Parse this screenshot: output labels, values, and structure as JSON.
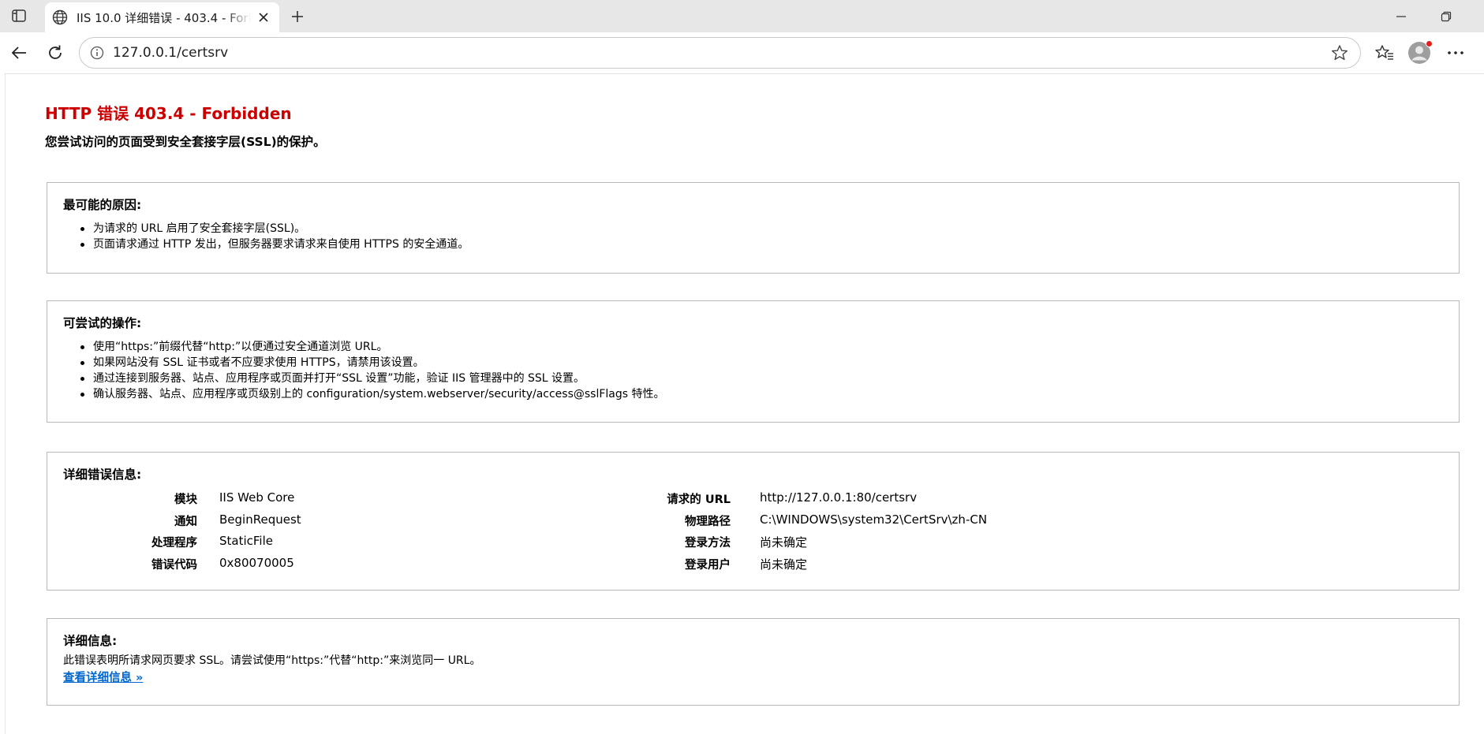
{
  "browser": {
    "tab": {
      "title": "IIS 10.0 详细错误 - 403.4 - Forbidden"
    },
    "address": {
      "url": "127.0.0.1/certsrv"
    },
    "icons": {
      "tab_actions": "tab-actions-icon",
      "favicon": "globe-icon",
      "close": "close-icon",
      "new_tab": "plus-icon",
      "back": "back-arrow-icon",
      "refresh": "refresh-icon",
      "site_info": "info-icon",
      "favorite": "star-icon",
      "favorites_bar": "favorites-icon",
      "profile": "profile-icon",
      "more": "more-icon",
      "minimize": "minimize-icon",
      "restore": "restore-icon"
    },
    "colors": {
      "tabbar_bg": "#e7e7e7",
      "profile_badge": "#e0201c"
    }
  },
  "page": {
    "title": "HTTP 错误 403.4 - Forbidden",
    "subtitle": "您尝试访问的页面受到安全套接字层(SSL)的保护。",
    "title_color": "#cc0000",
    "causes": {
      "heading": "最可能的原因:",
      "items": [
        "为请求的 URL 启用了安全套接字层(SSL)。",
        "页面请求通过 HTTP 发出，但服务器要求请求来自使用 HTTPS 的安全通道。"
      ]
    },
    "actions": {
      "heading": "可尝试的操作:",
      "items": [
        "使用“https:”前缀代替“http:”以便通过安全通道浏览 URL。",
        "如果网站没有 SSL 证书或者不应要求使用 HTTPS，请禁用该设置。",
        "通过连接到服务器、站点、应用程序或页面并打开“SSL 设置”功能，验证 IIS 管理器中的 SSL 设置。",
        "确认服务器、站点、应用程序或页级别上的 configuration/system.webserver/security/access@sslFlags 特性。"
      ]
    },
    "details": {
      "heading": "详细错误信息:",
      "rows": [
        {
          "label1": "模块",
          "value1": "IIS Web Core",
          "label2": "请求的 URL",
          "value2": "http://127.0.0.1:80/certsrv"
        },
        {
          "label1": "通知",
          "value1": "BeginRequest",
          "label2": "物理路径",
          "value2": "C:\\WINDOWS\\system32\\CertSrv\\zh-CN"
        },
        {
          "label1": "处理程序",
          "value1": "StaticFile",
          "label2": "登录方法",
          "value2": "尚未确定"
        },
        {
          "label1": "错误代码",
          "value1": "0x80070005",
          "label2": "登录用户",
          "value2": "尚未确定"
        }
      ]
    },
    "more_info": {
      "heading": "详细信息:",
      "text": "此错误表明所请求网页要求 SSL。请尝试使用“https:”代替“http:”来浏览同一 URL。",
      "link": "查看详细信息 »",
      "link_color": "#0066cc"
    }
  }
}
